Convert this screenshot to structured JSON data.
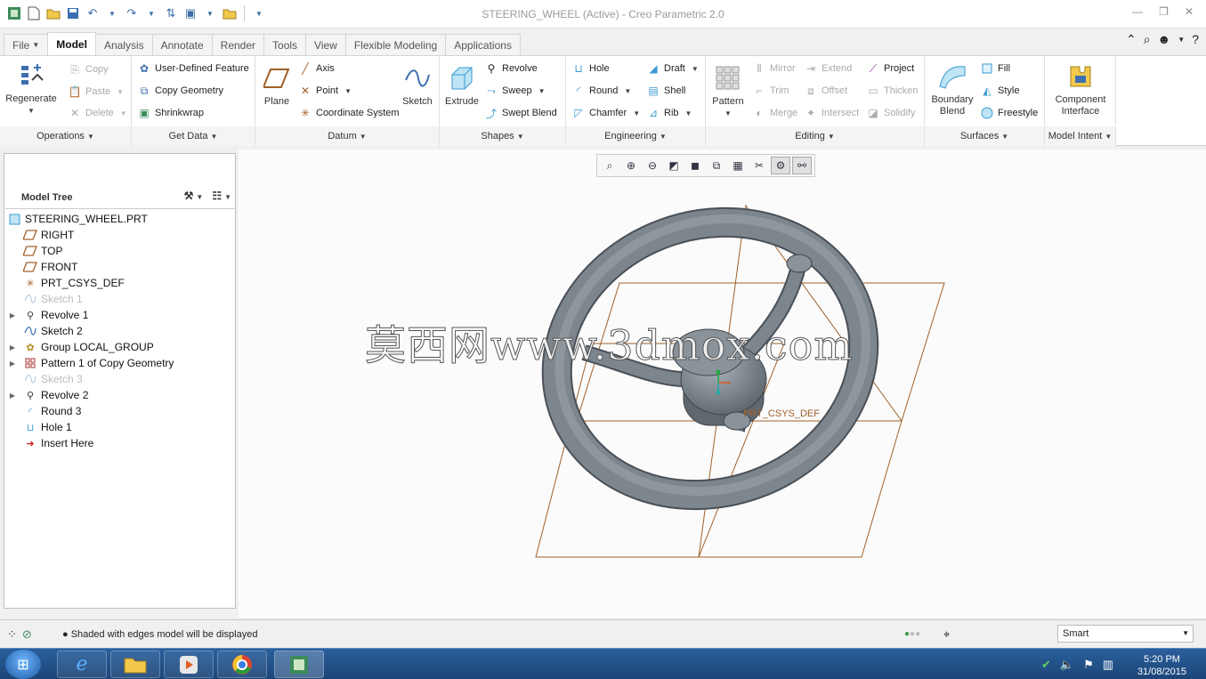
{
  "window": {
    "title": "STEERING_WHEEL (Active) - Creo Parametric 2.0"
  },
  "tabs": [
    {
      "label": "File"
    },
    {
      "label": "Model"
    },
    {
      "label": "Analysis"
    },
    {
      "label": "Annotate"
    },
    {
      "label": "Render"
    },
    {
      "label": "Tools"
    },
    {
      "label": "View"
    },
    {
      "label": "Flexible Modeling"
    },
    {
      "label": "Applications"
    }
  ],
  "ribbon": {
    "operations": {
      "regenerate": "Regenerate",
      "copy": "Copy",
      "paste": "Paste",
      "delete": "Delete",
      "label": "Operations"
    },
    "getdata": {
      "udf": "User-Defined Feature",
      "copygeom": "Copy Geometry",
      "shrinkwrap": "Shrinkwrap",
      "label": "Get Data"
    },
    "datum": {
      "plane": "Plane",
      "axis": "Axis",
      "point": "Point",
      "csys": "Coordinate System",
      "sketch": "Sketch",
      "label": "Datum"
    },
    "shapes": {
      "extrude": "Extrude",
      "revolve": "Revolve",
      "sweep": "Sweep",
      "swept_blend": "Swept Blend",
      "label": "Shapes"
    },
    "engineering": {
      "hole": "Hole",
      "round": "Round",
      "chamfer": "Chamfer",
      "draft": "Draft",
      "shell": "Shell",
      "rib": "Rib",
      "label": "Engineering"
    },
    "editing": {
      "pattern": "Pattern",
      "mirror": "Mirror",
      "trim": "Trim",
      "merge": "Merge",
      "extend": "Extend",
      "offset": "Offset",
      "intersect": "Intersect",
      "project": "Project",
      "thicken": "Thicken",
      "solidify": "Solidify",
      "label": "Editing"
    },
    "surfaces": {
      "boundary_blend_1": "Boundary",
      "boundary_blend_2": "Blend",
      "fill": "Fill",
      "style": "Style",
      "freestyle": "Freestyle",
      "label": "Surfaces"
    },
    "model_intent": {
      "component_1": "Component",
      "component_2": "Interface",
      "label": "Model Intent"
    }
  },
  "model_tree": {
    "title": "Model Tree",
    "items": [
      {
        "label": "STEERING_WHEEL.PRT",
        "icon": "part-icon",
        "expandable": false,
        "dim": false,
        "indent": 0
      },
      {
        "label": "RIGHT",
        "icon": "datum-plane-icon",
        "expandable": false,
        "dim": false,
        "indent": 1
      },
      {
        "label": "TOP",
        "icon": "datum-plane-icon",
        "expandable": false,
        "dim": false,
        "indent": 1
      },
      {
        "label": "FRONT",
        "icon": "datum-plane-icon",
        "expandable": false,
        "dim": false,
        "indent": 1
      },
      {
        "label": "PRT_CSYS_DEF",
        "icon": "csys-icon",
        "expandable": false,
        "dim": false,
        "indent": 1
      },
      {
        "label": "Sketch 1",
        "icon": "sketch-icon",
        "expandable": false,
        "dim": true,
        "indent": 1
      },
      {
        "label": "Revolve 1",
        "icon": "revolve-icon",
        "expandable": true,
        "dim": false,
        "indent": 1
      },
      {
        "label": "Sketch 2",
        "icon": "sketch-icon",
        "expandable": false,
        "dim": false,
        "indent": 1
      },
      {
        "label": "Group LOCAL_GROUP",
        "icon": "group-icon",
        "expandable": true,
        "dim": false,
        "indent": 1
      },
      {
        "label": "Pattern 1 of Copy Geometry",
        "icon": "pattern-icon",
        "expandable": true,
        "dim": false,
        "indent": 1
      },
      {
        "label": "Sketch 3",
        "icon": "sketch-icon",
        "expandable": false,
        "dim": true,
        "indent": 1
      },
      {
        "label": "Revolve 2",
        "icon": "revolve-icon",
        "expandable": true,
        "dim": false,
        "indent": 1
      },
      {
        "label": "Round 3",
        "icon": "round-icon",
        "expandable": false,
        "dim": false,
        "indent": 1
      },
      {
        "label": "Hole 1",
        "icon": "hole-icon",
        "expandable": false,
        "dim": false,
        "indent": 1
      },
      {
        "label": "Insert Here",
        "icon": "insert-arrow-icon",
        "expandable": false,
        "dim": false,
        "indent": 1
      }
    ]
  },
  "viewport": {
    "csys_label": "PRT_CSYS_DEF",
    "watermark": "莫西网www.3dmox.com"
  },
  "status": {
    "message": "Shaded with edges model will be displayed",
    "filter": "Smart"
  },
  "taskbar": {
    "time": "5:20 PM",
    "date": "31/08/2015"
  },
  "colors": {
    "accent": "#2b579a",
    "datum": "#a0602a",
    "model": "#7d858d"
  }
}
